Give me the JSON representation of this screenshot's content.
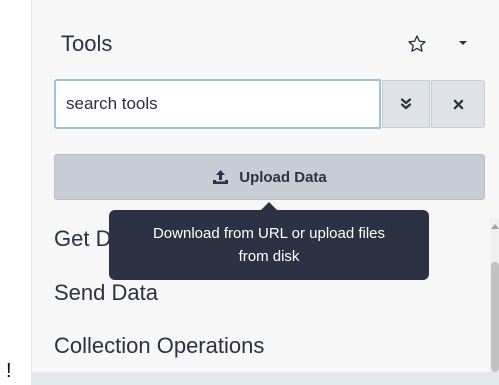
{
  "panel": {
    "title": "Tools"
  },
  "search": {
    "value": "search tools"
  },
  "upload": {
    "label": "Upload Data"
  },
  "tooltip": {
    "line1": "Download from URL or upload files",
    "line2": "from disk"
  },
  "sections": {
    "get_data": "Get Data",
    "send_data": "Send Data",
    "collection_operations": "Collection Operations"
  },
  "stray_mark": "!",
  "icons": {
    "favorite": "star-outline-icon",
    "menu": "caret-down-icon",
    "advanced": "double-chevron-down-icon",
    "clear": "close-icon",
    "upload": "upload-icon"
  },
  "colors": {
    "text": "#2c3143",
    "tooltip_bg": "#2c3143",
    "button_bg": "#c7cdd4",
    "input_border": "#9dc3d8"
  }
}
